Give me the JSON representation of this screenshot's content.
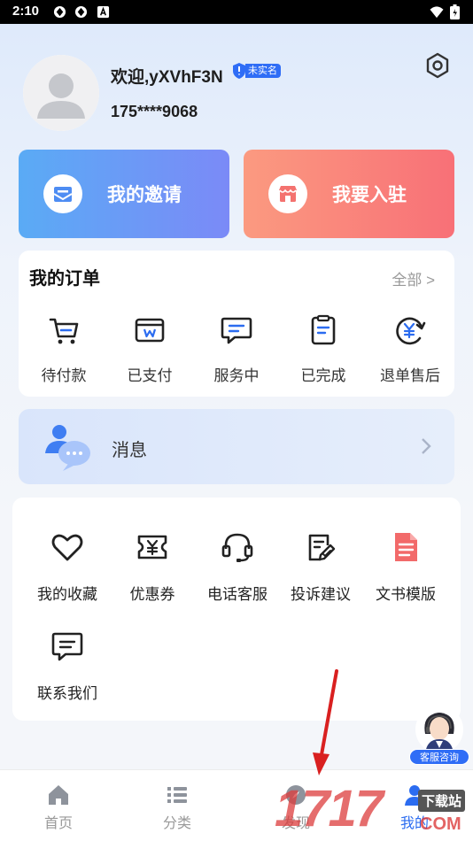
{
  "status_bar": {
    "time": "2:10"
  },
  "profile": {
    "greeting": "欢迎,yXVhF3N",
    "verify_badge": "未实名",
    "phone": "175****9068"
  },
  "cards": {
    "invite_label": "我的邀请",
    "join_label": "我要入驻"
  },
  "orders": {
    "title": "我的订单",
    "all_link": "全部 >",
    "items": [
      {
        "label": "待付款",
        "icon": "cart-icon"
      },
      {
        "label": "已支付",
        "icon": "paid-icon"
      },
      {
        "label": "服务中",
        "icon": "chat-icon"
      },
      {
        "label": "已完成",
        "icon": "clipboard-icon"
      },
      {
        "label": "退单售后",
        "icon": "refund-icon"
      }
    ]
  },
  "message": {
    "label": "消息"
  },
  "tools": {
    "items": [
      {
        "label": "我的收藏",
        "icon": "heart-icon"
      },
      {
        "label": "优惠券",
        "icon": "coupon-icon"
      },
      {
        "label": "电话客服",
        "icon": "headset-icon"
      },
      {
        "label": "投诉建议",
        "icon": "feedback-icon"
      },
      {
        "label": "文书模版",
        "icon": "document-icon"
      },
      {
        "label": "联系我们",
        "icon": "contact-icon"
      }
    ]
  },
  "customer_service": {
    "label": "客服咨询"
  },
  "bottom_nav": {
    "items": [
      {
        "label": "首页",
        "icon": "home-icon"
      },
      {
        "label": "分类",
        "icon": "list-icon"
      },
      {
        "label": "发现",
        "icon": "discover-icon"
      },
      {
        "label": "我的",
        "icon": "profile-icon"
      }
    ],
    "active_index": 3
  },
  "watermark": {
    "number": "1717",
    "tag": "下载站",
    "domain": "COM"
  },
  "colors": {
    "accent": "#2b6cf0",
    "invite_start": "#5aabf5",
    "invite_end": "#7b8af7",
    "join_start": "#fb9a80",
    "join_end": "#f87077",
    "document_red": "#f26a6a"
  }
}
